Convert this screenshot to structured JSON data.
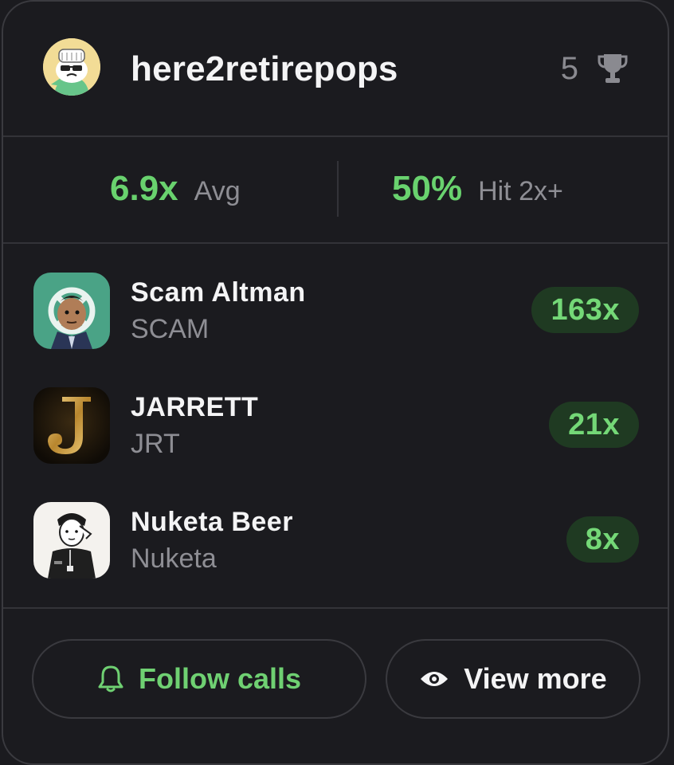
{
  "profile": {
    "username": "here2retirepops",
    "trophy_count": "5",
    "avatar_icon": "chef-cartoon-avatar",
    "trophy_icon": "trophy-icon"
  },
  "stats": {
    "avg_value": "6.9x",
    "avg_label": "Avg",
    "hit_value": "50%",
    "hit_label": "Hit 2x+"
  },
  "tokens": [
    {
      "name": "Scam Altman",
      "ticker": "SCAM",
      "multiplier": "163x"
    },
    {
      "name": "JARRETT",
      "ticker": "JRT",
      "multiplier": "21x"
    },
    {
      "name": "Nuketa Beer",
      "ticker": "Nuketa",
      "multiplier": "8x"
    }
  ],
  "actions": {
    "follow_label": "Follow calls",
    "follow_icon": "bell-icon",
    "view_label": "View more",
    "view_icon": "eye-icon"
  },
  "colors": {
    "accent_green": "#69d26e",
    "badge_bg": "#1f3a22",
    "card_bg": "#1b1b1f",
    "border": "#3a3a3f"
  }
}
